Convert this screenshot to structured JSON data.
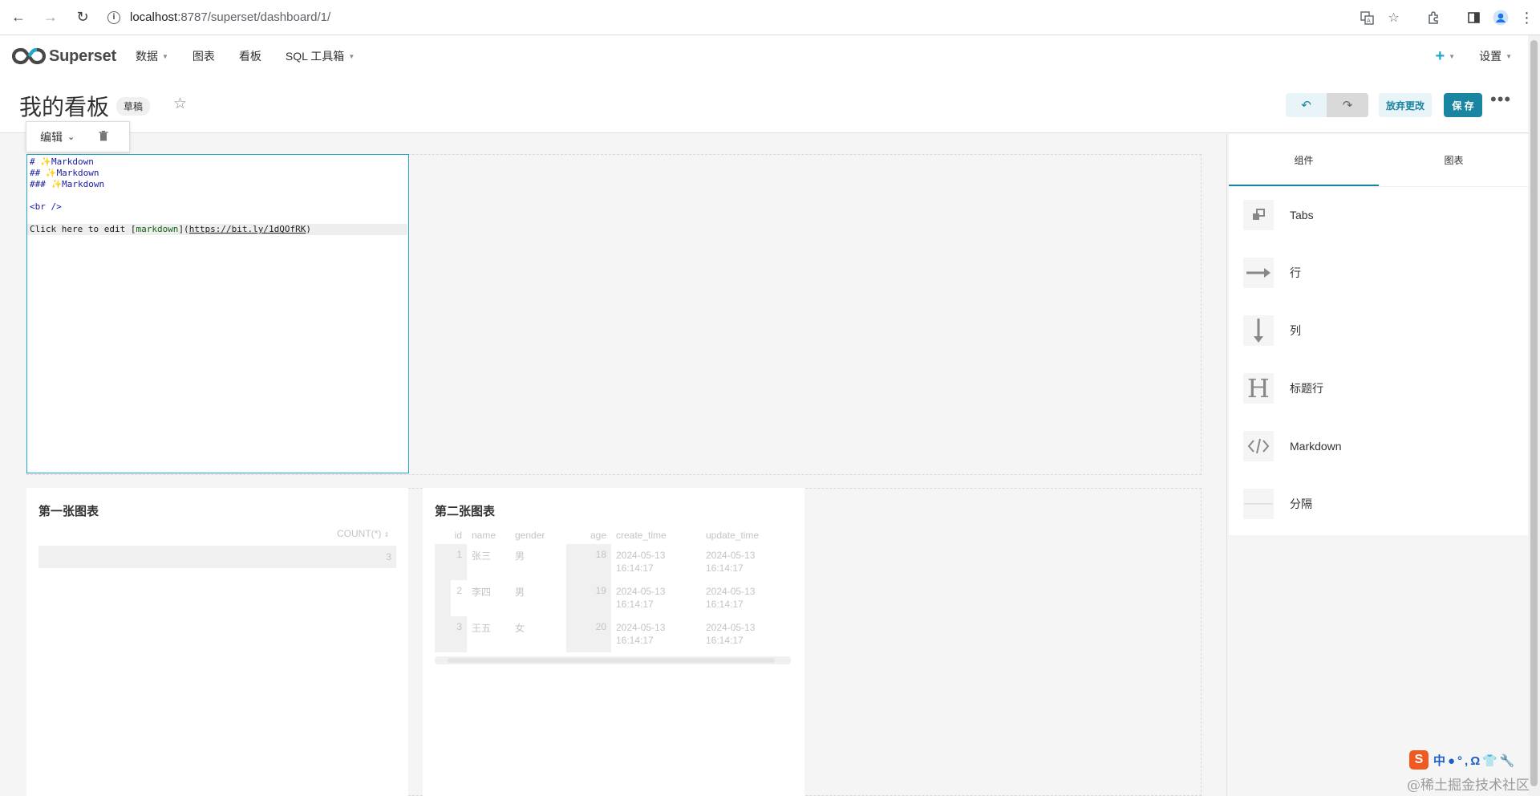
{
  "browser": {
    "url_host": "localhost",
    "url_path": ":8787/superset/dashboard/1/"
  },
  "app": {
    "logo_text": "Superset",
    "menu": [
      {
        "label": "数据",
        "dropdown": true
      },
      {
        "label": "图表",
        "dropdown": false
      },
      {
        "label": "看板",
        "dropdown": false
      },
      {
        "label": "SQL 工具箱",
        "dropdown": true
      }
    ],
    "settings_label": "设置",
    "accent_color": "#20a7c9"
  },
  "dashboard": {
    "title": "我的看板",
    "status_badge": "草稿",
    "discard_label": "放弃更改",
    "save_label": "保 存"
  },
  "markdown_editor": {
    "popover_edit_label": "编辑",
    "lines": [
      {
        "text": "# ✨Markdown",
        "style": "blue"
      },
      {
        "text": "## ✨Markdown",
        "style": "blue"
      },
      {
        "text": "### ✨Markdown",
        "style": "blue"
      },
      {
        "text": "",
        "style": "text"
      },
      {
        "text": "<br />",
        "style": "blue"
      },
      {
        "text": "",
        "style": "text"
      }
    ],
    "last_line": {
      "prefix": "Click here to edit [",
      "link_text": "markdown",
      "middle": "](",
      "url": "https://bit.ly/1dQOfRK",
      "suffix": ")"
    }
  },
  "charts": [
    {
      "title": "第一张图表",
      "columns": [
        "COUNT(*)"
      ],
      "rows": [
        [
          "3"
        ]
      ]
    },
    {
      "title": "第二张图表",
      "columns": [
        "id",
        "name",
        "gender",
        "age",
        "create_time",
        "update_time"
      ],
      "rows": [
        {
          "id": "1",
          "name": "张三",
          "gender": "男",
          "age": "18",
          "create_time": "2024-05-13 16:14:17",
          "update_time": "2024-05-13 16:14:17"
        },
        {
          "id": "2",
          "name": "李四",
          "gender": "男",
          "age": "19",
          "create_time": "2024-05-13 16:14:17",
          "update_time": "2024-05-13 16:14:17"
        },
        {
          "id": "3",
          "name": "王五",
          "gender": "女",
          "age": "20",
          "create_time": "2024-05-13 16:14:17",
          "update_time": "2024-05-13 16:14:17"
        }
      ]
    }
  ],
  "side_panel": {
    "tabs": [
      {
        "label": "组件",
        "active": true
      },
      {
        "label": "图表",
        "active": false
      }
    ],
    "components": [
      {
        "label": "Tabs",
        "icon": "tabs-icon"
      },
      {
        "label": "行",
        "icon": "row-arrow-icon"
      },
      {
        "label": "列",
        "icon": "column-arrow-icon"
      },
      {
        "label": "标题行",
        "icon": "header-h-icon"
      },
      {
        "label": "Markdown",
        "icon": "code-icon"
      },
      {
        "label": "分隔",
        "icon": "divider-icon"
      }
    ]
  },
  "overlay": {
    "ime_text": "中●°,Ω👕🔧",
    "watermark": "@稀土掘金技术社区"
  }
}
